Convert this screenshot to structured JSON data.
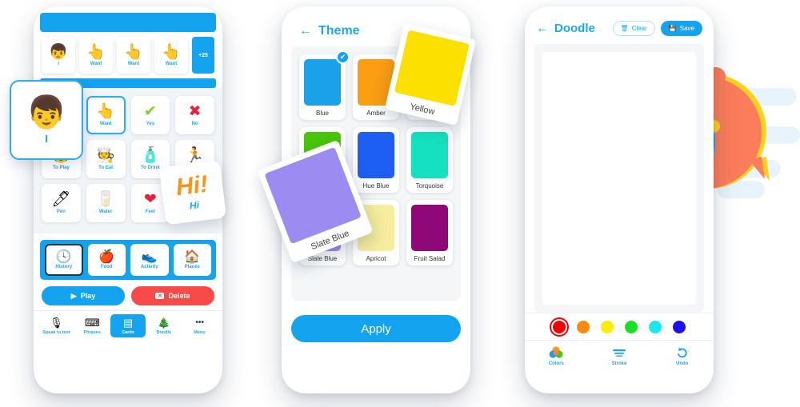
{
  "phone_cards": {
    "sentence_strip": [
      {
        "icon": "boy-face",
        "glyph": "👦",
        "label": "I"
      },
      {
        "icon": "pointing-hand",
        "glyph": "👆",
        "label": "Want"
      },
      {
        "icon": "pointing-hand",
        "glyph": "👆",
        "label": "Want"
      },
      {
        "icon": "pointing-hand",
        "glyph": "👆",
        "label": "Want"
      }
    ],
    "more_badge": "+25",
    "grid": [
      {
        "icon": "pointing-hand",
        "glyph": "👆",
        "label": "Want",
        "selected": true
      },
      {
        "icon": "check-mark",
        "glyph": "✔",
        "label": "Yes",
        "selected": false
      },
      {
        "icon": "cross-mark",
        "glyph": "✖",
        "label": "No",
        "selected": false
      },
      {
        "icon": "playing-child",
        "glyph": "🧒",
        "label": "To Play",
        "selected": false
      },
      {
        "icon": "eating-person",
        "glyph": "🧑‍🍳",
        "label": "To Eat",
        "selected": false
      },
      {
        "icon": "water-bottle",
        "glyph": "🧴",
        "label": "To Drink",
        "selected": false
      },
      {
        "icon": "running-person",
        "glyph": "🏃",
        "label": "To Go",
        "selected": false
      },
      {
        "icon": "pen",
        "glyph": "🖊",
        "label": "Pen",
        "selected": false
      },
      {
        "icon": "water-glass",
        "glyph": "🥛",
        "label": "Water",
        "selected": false
      },
      {
        "icon": "heart",
        "glyph": "❤",
        "label": "Feel",
        "selected": false
      }
    ],
    "categories": [
      {
        "icon": "clock-history",
        "glyph": "🕓",
        "label": "History",
        "selected": true
      },
      {
        "icon": "apple",
        "glyph": "🍎",
        "label": "Food",
        "selected": false
      },
      {
        "icon": "sneakers",
        "glyph": "👟",
        "label": "Activity",
        "selected": false
      },
      {
        "icon": "house",
        "glyph": "🏠",
        "label": "Places",
        "selected": false
      }
    ],
    "actions": {
      "play_label": "Play",
      "delete_label": "Delete"
    },
    "tabs": [
      {
        "icon": "microphone-icon",
        "glyph": "🎙",
        "label": "Speak to text",
        "selected": false
      },
      {
        "icon": "keyboard-icon",
        "glyph": "⌨",
        "label": "Phrases",
        "selected": false
      },
      {
        "icon": "cards-icon",
        "glyph": "▤",
        "label": "Cards",
        "selected": true
      },
      {
        "icon": "doodle-icon",
        "glyph": "🎄",
        "label": "Doodle",
        "selected": false
      },
      {
        "icon": "menu-dots-icon",
        "glyph": "•••",
        "label": "Menu",
        "selected": false
      }
    ],
    "floating_avatar": {
      "icon": "boy-face",
      "glyph": "👦",
      "label": "I"
    },
    "floating_hi": {
      "big": "Hi!",
      "small": "Hi"
    }
  },
  "phone_theme": {
    "title": "Theme",
    "back_icon": "←",
    "swatches": [
      {
        "label": "Blue",
        "color": "#1BA1E8",
        "selected": true
      },
      {
        "label": "Amber",
        "color": "#FB9E12",
        "selected": false
      },
      {
        "label": "Yellow",
        "color": "#FCE000",
        "selected": false
      },
      {
        "label": "Hue Blue",
        "color": "#1D5FF2",
        "selected": false
      },
      {
        "label": "Torquoise",
        "color": "#15E0C0",
        "selected": false
      },
      {
        "label": "Green",
        "color": "#4BC50C",
        "selected": false
      },
      {
        "label": "Apricot",
        "color": "#F6EE9E",
        "selected": false
      },
      {
        "label": "Fruit Salad",
        "color": "#8E0877",
        "selected": false
      },
      {
        "label": "Slate Blue",
        "color": "#9C8CF2",
        "selected": false
      }
    ],
    "grid_order": [
      {
        "label": "Blue",
        "color": "#1BA1E8",
        "selected": true
      },
      {
        "label": "Amber",
        "color": "#FB9E12",
        "selected": false
      },
      {
        "label": "Yellow",
        "color": "#FCE000",
        "selected": false
      },
      {
        "label": "Green",
        "color": "#4BC50C",
        "selected": false
      },
      {
        "label": "Hue Blue",
        "color": "#1D5FF2",
        "selected": false
      },
      {
        "label": "Torquoise",
        "color": "#15E0C0",
        "selected": false
      },
      {
        "label": "Slate Blue",
        "color": "#9C8CF2",
        "selected": false
      },
      {
        "label": "Apricot",
        "color": "#F6EE9E",
        "selected": false
      },
      {
        "label": "Fruit Salad",
        "color": "#8E0877",
        "selected": false
      }
    ],
    "check_glyph": "✔",
    "apply_label": "Apply",
    "floating_yellow": {
      "label": "Yellow",
      "color": "#FCE000"
    },
    "floating_slate": {
      "label": "Slate Blue",
      "color": "#9C8CF2"
    }
  },
  "phone_doodle": {
    "title": "Doodle",
    "back_icon": "←",
    "clear_label": "Clear",
    "clear_icon": "🗑",
    "save_label": "Save",
    "save_icon": "💾",
    "colors": [
      {
        "name": "red",
        "hex": "#F40000",
        "selected": true
      },
      {
        "name": "orange",
        "hex": "#FC8A10",
        "selected": false
      },
      {
        "name": "yellow",
        "hex": "#FBEC00",
        "selected": false
      },
      {
        "name": "green",
        "hex": "#18E022",
        "selected": false
      },
      {
        "name": "cyan",
        "hex": "#18E7F4",
        "selected": false
      },
      {
        "name": "blue",
        "hex": "#1A11EE",
        "selected": false
      }
    ],
    "tools": [
      {
        "icon": "color-palette-icon",
        "label": "Colors"
      },
      {
        "icon": "stroke-lines-icon",
        "label": "Stroke"
      },
      {
        "icon": "undo-arrow-icon",
        "label": "Undo"
      }
    ]
  },
  "artwork": {
    "bubble_blue": "#9BDCF7",
    "bubble_blue_edge": "#1BA1E8",
    "bubble_orange": "#FB7D5B",
    "bubble_orange_edge": "#FCD21C",
    "face_dark": "#13293D",
    "tongue": "#F96A6A",
    "dot_yellow": "#FCD21C",
    "dot_blue": "#1BA1E8",
    "dot_orange": "#FB7D5B",
    "streak": "#E4F2FB"
  }
}
